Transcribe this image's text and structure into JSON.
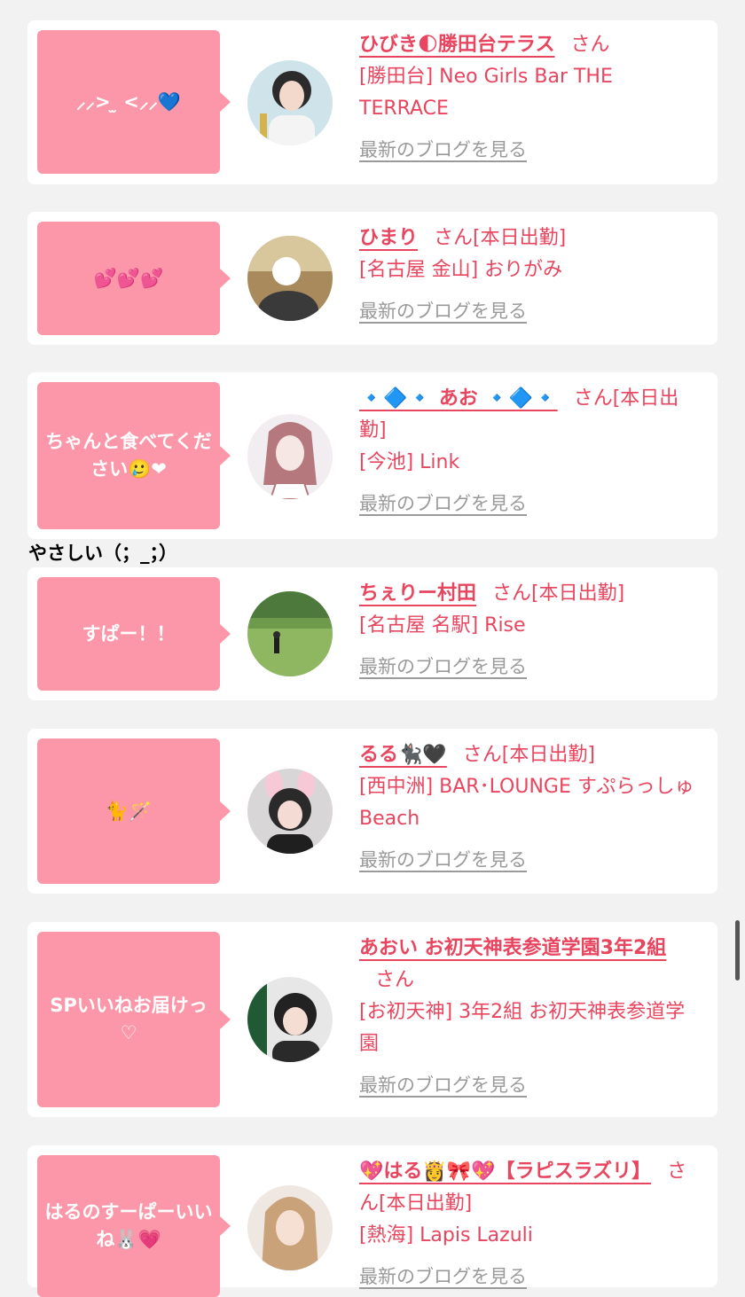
{
  "cards": [
    {
      "bubble": "⸝⸝> ̫ <⸝⸝💙",
      "name": "ひびき🌓勝田台テラス",
      "suffix": "さん",
      "shop": "[勝田台] Neo Girls Bar THE TERRACE",
      "blog": "最新のブログを見る"
    },
    {
      "bubble": "💕💕💕",
      "name": "ひまり",
      "suffix": "さん[本日出勤]",
      "shop": "[名古屋 金山] おりがみ",
      "blog": "最新のブログを見る"
    },
    {
      "bubble": "ちゃんと食べてください🥲❤",
      "name": "🔹🔷🔹 あお 🔹🔷🔹",
      "suffix": "さん[本日出勤]",
      "shop": "[今池] Link",
      "blog": "最新のブログを見る"
    },
    {
      "bubble": "すぱー！！",
      "name": "ちぇりー村田",
      "suffix": "さん[本日出勤]",
      "shop": "[名古屋 名駅] Rise",
      "blog": "最新のブログを見る"
    },
    {
      "bubble": "🐈🪄",
      "name": "るる🐈‍⬛🖤",
      "suffix": "さん[本日出勤]",
      "shop": "[西中洲] BAR･LOUNGE すぷらっしゅBeach",
      "blog": "最新のブログを見る"
    },
    {
      "bubble": "SPいいねお届けっ♡",
      "name": "あおい お初天神表参道学園3年2組",
      "suffix": "さん",
      "shop": "[お初天神] 3年2組 お初天神表参道学園",
      "blog": "最新のブログを見る"
    },
    {
      "bubble": "はるのすーぱーいいね🐰💗",
      "name": "💖はる👸🎀💖【ラピスラズリ】",
      "suffix": "さん[本日出勤]",
      "shop": "[熱海] Lapis Lazuli",
      "blog": "最新のブログを見る"
    }
  ],
  "comment": "やさしい（；_；）",
  "colors": {
    "accent": "#e8455f",
    "bubble": "#fb97a8",
    "background": "#f2f2f2"
  }
}
